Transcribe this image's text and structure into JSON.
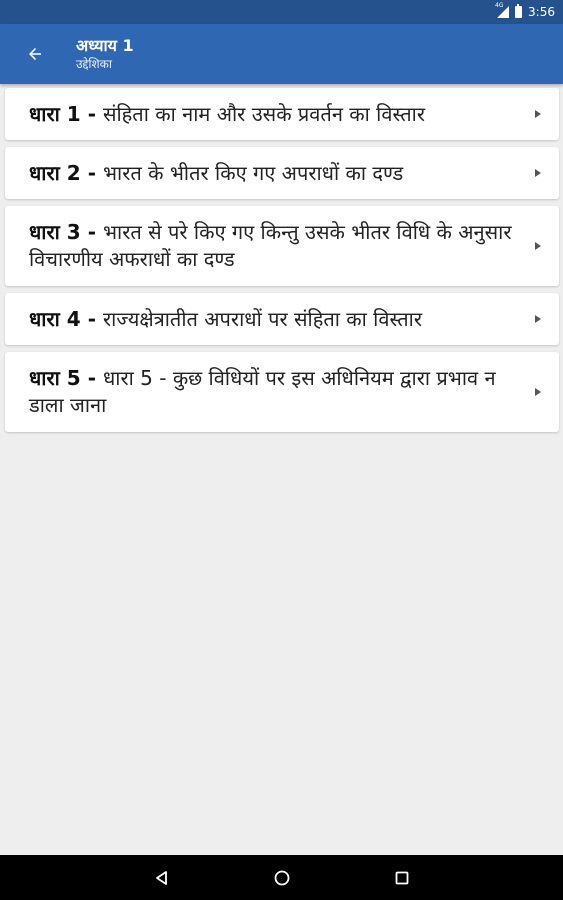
{
  "status_bar": {
    "time": "3:56",
    "signal_tag": "4G"
  },
  "app_bar": {
    "title": "अध्याय 1",
    "subtitle": "उद्देशिका"
  },
  "sections": [
    {
      "label": "धारा 1",
      "separator": " - ",
      "title": "संहिता का नाम और उसके प्रवर्तन का विस्तार"
    },
    {
      "label": "धारा 2",
      "separator": " - ",
      "title": "भारत के भीतर किए गए अपराधों का दण्ड"
    },
    {
      "label": "धारा 3",
      "separator": " - ",
      "title": "भारत से परे किए गए किन्तु उसके भीतर विधि के अनुसार विचारणीय अफराधों का दण्ड"
    },
    {
      "label": "धारा 4",
      "separator": " - ",
      "title": "राज्यक्षेत्रातीत अपराधों पर संहिता का विस्तार"
    },
    {
      "label": "धारा 5",
      "separator": " - ",
      "title": "धारा 5 - कुछ विधियों पर इस अधिनियम द्वारा प्रभाव न डाला जाना"
    }
  ],
  "icons": {
    "back": "arrow-left-icon",
    "chevron": "chevron-right-icon",
    "nav_back": "triangle-back-icon",
    "nav_home": "circle-home-icon",
    "nav_recents": "square-recents-icon"
  },
  "colors": {
    "status_bar": "#25528c",
    "app_bar": "#3067b3",
    "background": "#eeeeee",
    "card": "#ffffff",
    "nav_bar": "#000000"
  }
}
